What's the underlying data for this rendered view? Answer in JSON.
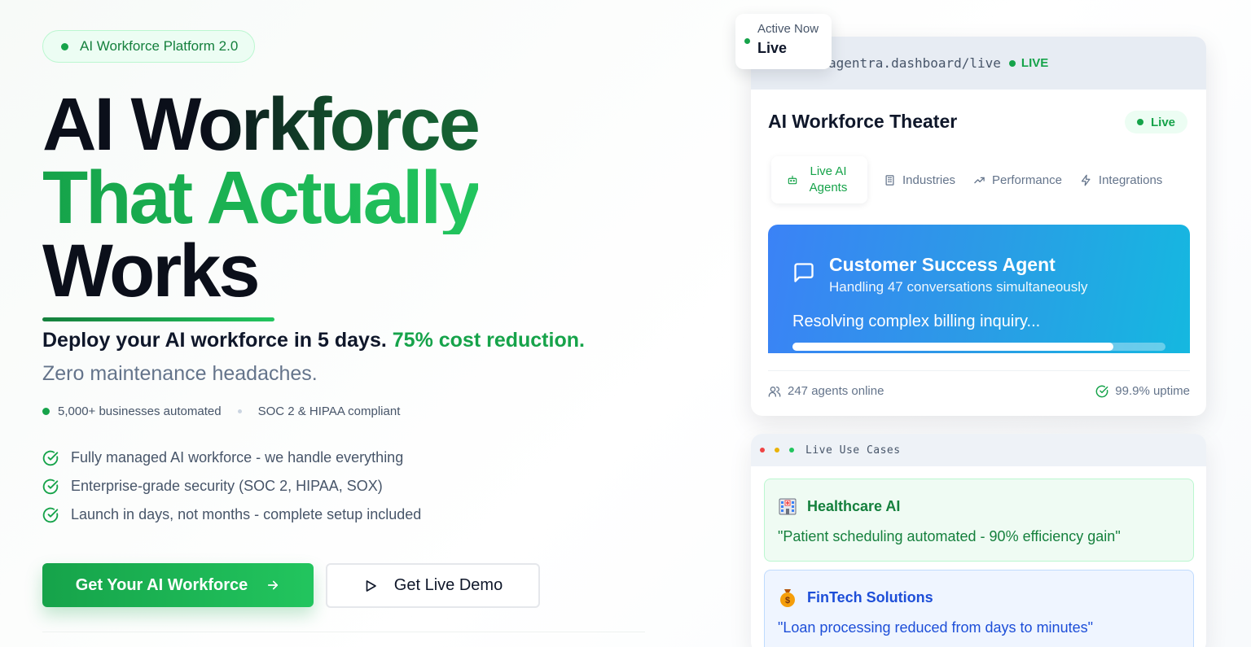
{
  "hero": {
    "badge": "AI Workforce Platform 2.0",
    "headline_line1": "AI Workforce",
    "headline_line2": "That Actually",
    "headline_line3": "Works",
    "tagline_main": "Deploy your AI workforce in 5 days.",
    "tagline_highlight": "75% cost reduction.",
    "tagline_sub": "Zero maintenance headaches.",
    "stat_1": "5,000+ businesses automated",
    "stat_2": "SOC 2 & HIPAA compliant",
    "features": [
      "Fully managed AI workforce - we handle everything",
      "Enterprise-grade security (SOC 2, HIPAA, SOX)",
      "Launch in days, not months - complete setup included"
    ],
    "primary_cta": "Get Your AI Workforce",
    "secondary_cta": "Get Live Demo"
  },
  "dashboard": {
    "url": "agentra.dashboard/live",
    "url_status": "LIVE",
    "active_label": "Active Now",
    "active_value": "Live",
    "title": "AI Workforce Theater",
    "status_pill": "Live",
    "tabs": [
      {
        "label": "Live AI Agents",
        "icon": "robot-icon"
      },
      {
        "label": "Industries",
        "icon": "building-icon"
      },
      {
        "label": "Performance",
        "icon": "trending-up-icon"
      },
      {
        "label": "Integrations",
        "icon": "zap-icon"
      }
    ],
    "agent": {
      "name": "Customer Success Agent",
      "subtitle": "Handling 47 conversations simultaneously",
      "task": "Resolving complex billing inquiry...",
      "progress": 0.86
    },
    "footer_agents": "247 agents online",
    "footer_uptime": "99.9% uptime"
  },
  "use_cases": {
    "window_title": "Live Use Cases",
    "items": [
      {
        "title": "Healthcare AI",
        "quote": "\"Patient scheduling automated - 90% efficiency gain\"",
        "icon": "hospital-icon"
      },
      {
        "title": "FinTech Solutions",
        "quote": "\"Loan processing reduced from days to minutes\"",
        "icon": "money-bag-icon"
      }
    ]
  },
  "colors": {
    "brand_green": "#16a34a",
    "agent_card_blue": "#3b82f6",
    "agent_card_cyan": "#15b8e0"
  }
}
